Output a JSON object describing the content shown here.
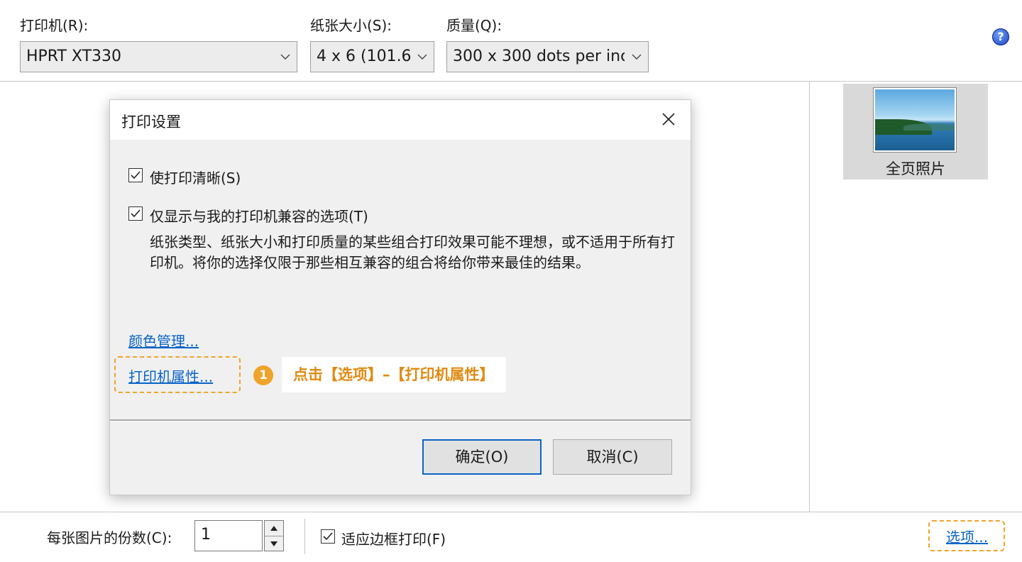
{
  "toolbar": {
    "printer_label": "打印机(R):",
    "printer_value": "HPRT XT330",
    "paper_label": "纸张大小(S):",
    "paper_value": "4 x 6 (101.6",
    "quality_label": "质量(Q):",
    "quality_value": "300 x 300 dots per inc",
    "help_glyph": "?"
  },
  "layouts": {
    "items": [
      {
        "label": "全页照片",
        "selected": true
      }
    ]
  },
  "dialog": {
    "title": "打印设置",
    "close_glyph": "✕",
    "checkbox_sharpen": {
      "label": "使打印清晰(S)",
      "checked": true
    },
    "checkbox_compatible": {
      "label": "仅显示与我的打印机兼容的选项(T)",
      "checked": true
    },
    "description": "纸张类型、纸张大小和打印质量的某些组合打印效果可能不理想，或不适用于所有打印机。将你的选择仅限于那些相互兼容的组合将给你带来最佳的结果。",
    "color_management_link": "颜色管理...",
    "printer_properties_link": "打印机属性...",
    "ok_button": "确定(O)",
    "cancel_button": "取消(C)"
  },
  "annotation": {
    "step_number": "1",
    "text": "点击【选项】–【打印机属性】",
    "color": "#f0a32a"
  },
  "bottom": {
    "copies_label": "每张图片的份数(C):",
    "copies_value": "1",
    "fit_frame": {
      "label": "适应边框打印(F)",
      "checked": true
    },
    "options_link": "选项..."
  }
}
